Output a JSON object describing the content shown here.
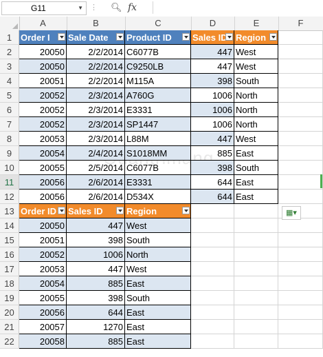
{
  "formula_bar": {
    "name_box": "G11",
    "fx_label": "fx",
    "formula_value": ""
  },
  "columns": [
    "A",
    "B",
    "C",
    "D",
    "E",
    "F"
  ],
  "rows": [
    "1",
    "2",
    "3",
    "4",
    "5",
    "6",
    "7",
    "8",
    "9",
    "10",
    "11",
    "12",
    "13",
    "14",
    "15",
    "16",
    "17",
    "18",
    "19",
    "20",
    "21",
    "22"
  ],
  "active_row": "11",
  "table1": {
    "headers": [
      "Order I",
      "Sale Date",
      "Product ID"
    ],
    "rows": [
      [
        "20050",
        "2/2/2014",
        "C6077B"
      ],
      [
        "20050",
        "2/2/2014",
        "C9250LB"
      ],
      [
        "20051",
        "2/2/2014",
        "M115A"
      ],
      [
        "20052",
        "2/3/2014",
        "A760G"
      ],
      [
        "20052",
        "2/3/2014",
        "E3331"
      ],
      [
        "20052",
        "2/3/2014",
        "SP1447"
      ],
      [
        "20053",
        "2/3/2014",
        "L88M"
      ],
      [
        "20054",
        "2/4/2014",
        "S1018MM"
      ],
      [
        "20055",
        "2/5/2014",
        "C6077B"
      ],
      [
        "20056",
        "2/6/2014",
        "E3331"
      ],
      [
        "20056",
        "2/6/2014",
        "D534X"
      ]
    ]
  },
  "table2": {
    "headers": [
      "Sales ID",
      "Region"
    ],
    "rows": [
      [
        "447",
        "West"
      ],
      [
        "447",
        "West"
      ],
      [
        "398",
        "South"
      ],
      [
        "1006",
        "North"
      ],
      [
        "1006",
        "North"
      ],
      [
        "1006",
        "North"
      ],
      [
        "447",
        "West"
      ],
      [
        "885",
        "East"
      ],
      [
        "398",
        "South"
      ],
      [
        "644",
        "East"
      ],
      [
        "644",
        "East"
      ]
    ]
  },
  "table3": {
    "headers": [
      "Order ID",
      "Sales ID",
      "Region"
    ],
    "rows": [
      [
        "20050",
        "447",
        "West"
      ],
      [
        "20051",
        "398",
        "South"
      ],
      [
        "20052",
        "1006",
        "North"
      ],
      [
        "20053",
        "447",
        "West"
      ],
      [
        "20054",
        "885",
        "East"
      ],
      [
        "20055",
        "398",
        "South"
      ],
      [
        "20056",
        "644",
        "East"
      ],
      [
        "20057",
        "1270",
        "East"
      ],
      [
        "20058",
        "885",
        "East"
      ]
    ]
  },
  "watermark": "Quantrimang",
  "colors": {
    "header_blue": "#4f81bd",
    "header_orange": "#f28b2b",
    "band_blue": "#dce6f1",
    "active_green": "#217346"
  }
}
